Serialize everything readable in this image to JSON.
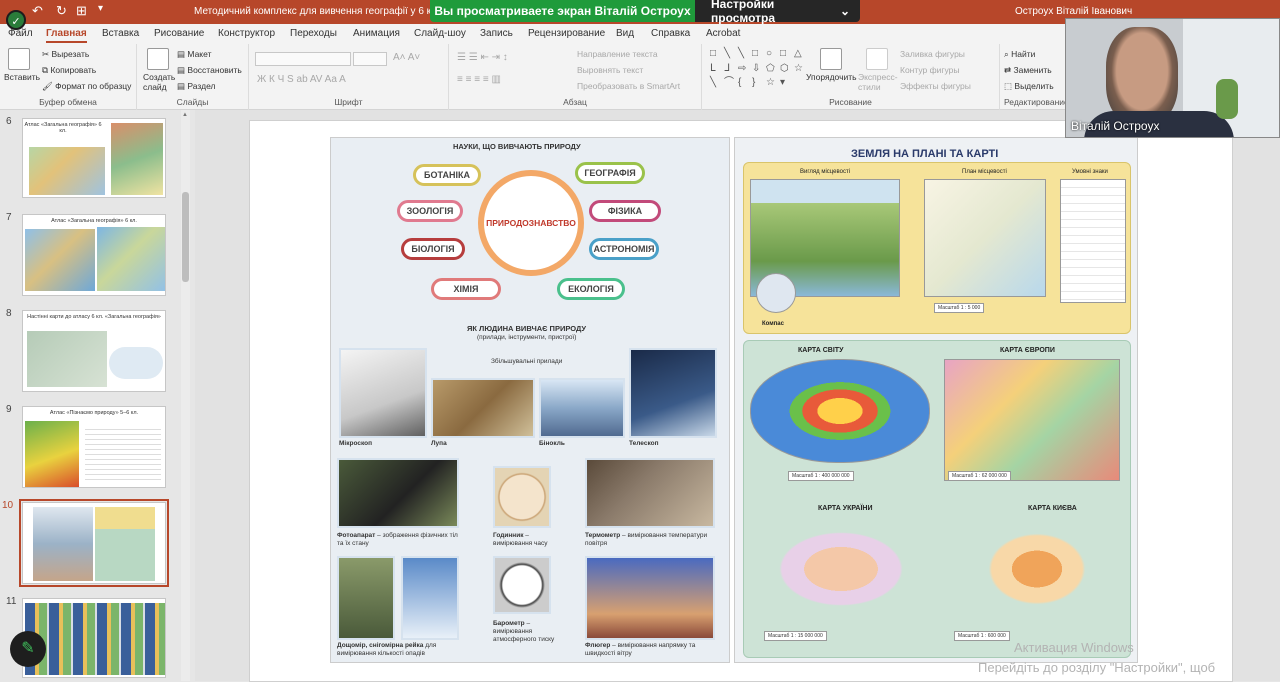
{
  "titlebar": {
    "doc_title": "Методичний комплекс для вивчення географії у 6 кл. - PowerP",
    "user_name": "Остроух Віталій Іванович"
  },
  "zoom": {
    "viewing_message": "Вы просматриваете экран Віталій Остроух",
    "view_options": "Настройки просмотра",
    "participant_name": "Віталій Остроух"
  },
  "tabs": [
    "Файл",
    "Главная",
    "Вставка",
    "Рисование",
    "Конструктор",
    "Переходы",
    "Анимация",
    "Слайд-шоу",
    "Запись",
    "Рецензирование",
    "Вид",
    "Справка",
    "Acrobat"
  ],
  "ribbon": {
    "clipboard": {
      "paste": "Вставить",
      "cut": "Вырезать",
      "copy": "Копировать",
      "format_painter": "Формат по образцу",
      "label": "Буфер обмена"
    },
    "slides": {
      "new_slide": "Создать слайд",
      "layout": "Макет",
      "reset": "Восстановить",
      "section": "Раздел",
      "label": "Слайды"
    },
    "font": {
      "label": "Шрифт"
    },
    "paragraph": {
      "text_direction": "Направление текста",
      "align_text": "Выровнять текст",
      "smartart": "Преобразовать в SmartArt",
      "label": "Абзац"
    },
    "drawing": {
      "arrange": "Упорядочить",
      "quick_styles": "Экспресс-стили",
      "fill": "Заливка фигуры",
      "outline": "Контур фигуры",
      "effects": "Эффекты фигуры",
      "label": "Рисование"
    },
    "editing": {
      "find": "Найти",
      "replace": "Заменить",
      "select": "Выделить",
      "label": "Редактирование"
    }
  },
  "slides": [
    {
      "num": "6",
      "title": "Атлас «Загальна географія» 6 кл."
    },
    {
      "num": "7",
      "title": "Атлас «Загальна географія» 6 кл."
    },
    {
      "num": "8",
      "title": "Настінні карти до атласу 6 кл. «Загальна географія»"
    },
    {
      "num": "9",
      "title": "Атлас «Пізнаємо природу» 5–6 кл."
    },
    {
      "num": "10",
      "title": ""
    },
    {
      "num": "11",
      "title": ""
    }
  ],
  "left_page": {
    "heading1": "НАУКИ, ЩО ВИВЧАЮТЬ ПРИРОДУ",
    "center": "ПРИРОДОЗНАВСТВО",
    "sciences": [
      "БОТАНІКА",
      "ГЕОГРАФІЯ",
      "ЗООЛОГІЯ",
      "ФІЗИКА",
      "БІОЛОГІЯ",
      "АСТРОНОМІЯ",
      "ХІМІЯ",
      "ЕКОЛОГІЯ"
    ],
    "heading2": "ЯК ЛЮДИНА ВИВЧАЄ ПРИРОДУ",
    "subheading2": "(прилади, інструменти, пристрої)",
    "magnifiers": "Збільшувальні прилади",
    "captions": {
      "microscope": "Мікроскоп",
      "loupe": "Лупа",
      "binoculars": "Бінокль",
      "telescope": "Телескоп",
      "camera": "Фотоапарат",
      "camera_desc": " – зображення фізичних тіл та їх стану",
      "clock": "Годинник",
      "clock_desc": " – вимірювання часу",
      "thermometer": "Термометр",
      "thermometer_desc": " – вимірювання температури повітря",
      "raingauge": "Дощомір, снігомірна рейка",
      "raingauge_desc": " для вимірювання кількості опадів",
      "barometer": "Барометр",
      "barometer_desc": " – вимірювання атмосферного тиску",
      "vane": "Флюгер",
      "vane_desc": " – вимірювання напрямку та швидкості вітру"
    }
  },
  "right_page": {
    "heading": "ЗЕМЛЯ НА ПЛАНІ ТА КАРТІ",
    "terrain_view": "Вигляд місцевості",
    "plan": "План місцевості",
    "legend": "Умовні знаки",
    "compass": "Компас",
    "plan_scale": "Масштаб 1 : 5 000",
    "world_map": "КАРТА СВІТУ",
    "world_scale": "Масштаб 1 : 400 000 000",
    "europe_map": "КАРТА ЄВРОПИ",
    "europe_scale": "Масштаб 1 : 62 000 000",
    "ukraine_map": "КАРТА УКРАЇНИ",
    "ukraine_scale": "Масштаб 1 : 15 000 000",
    "kyiv_map": "КАРТА КИЄВА",
    "kyiv_scale": "Масштаб 1 : 600 000"
  },
  "windows_activation": {
    "line1": "Активация Windows",
    "line2": "Перейдіть до розділу \"Настройки\", щоб"
  }
}
